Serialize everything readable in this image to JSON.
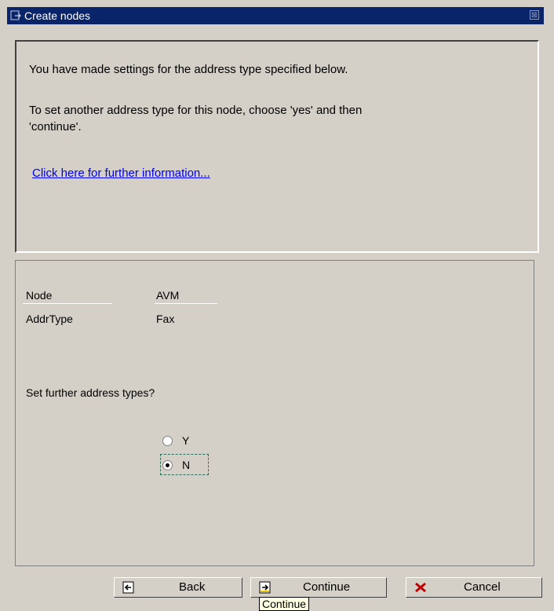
{
  "window": {
    "title": "Create nodes",
    "close_symbol": "⊠"
  },
  "message": {
    "line1": "You have made settings for the address type specified below.",
    "line2": "To set another address type for this node, choose 'yes' and then",
    "line3": "'continue'.",
    "link": "Click here for further information..."
  },
  "fields": {
    "node_label": "Node",
    "node_value": "AVM",
    "addrtype_label": "AddrType",
    "addrtype_value": "Fax"
  },
  "question": {
    "text": "Set further address types?",
    "options": [
      {
        "label": "Y",
        "selected": false
      },
      {
        "label": "N",
        "selected": true
      }
    ]
  },
  "buttons": {
    "back": "Back",
    "continue": "Continue",
    "cancel": "Cancel"
  },
  "tooltip": "Continue",
  "icons": {
    "title": "window-icon",
    "back": "back-icon",
    "continue": "continue-icon",
    "cancel": "cancel-icon"
  },
  "colors": {
    "titlebar": "#0a246a",
    "link": "#0000ee",
    "cancel_icon": "#c00000"
  }
}
